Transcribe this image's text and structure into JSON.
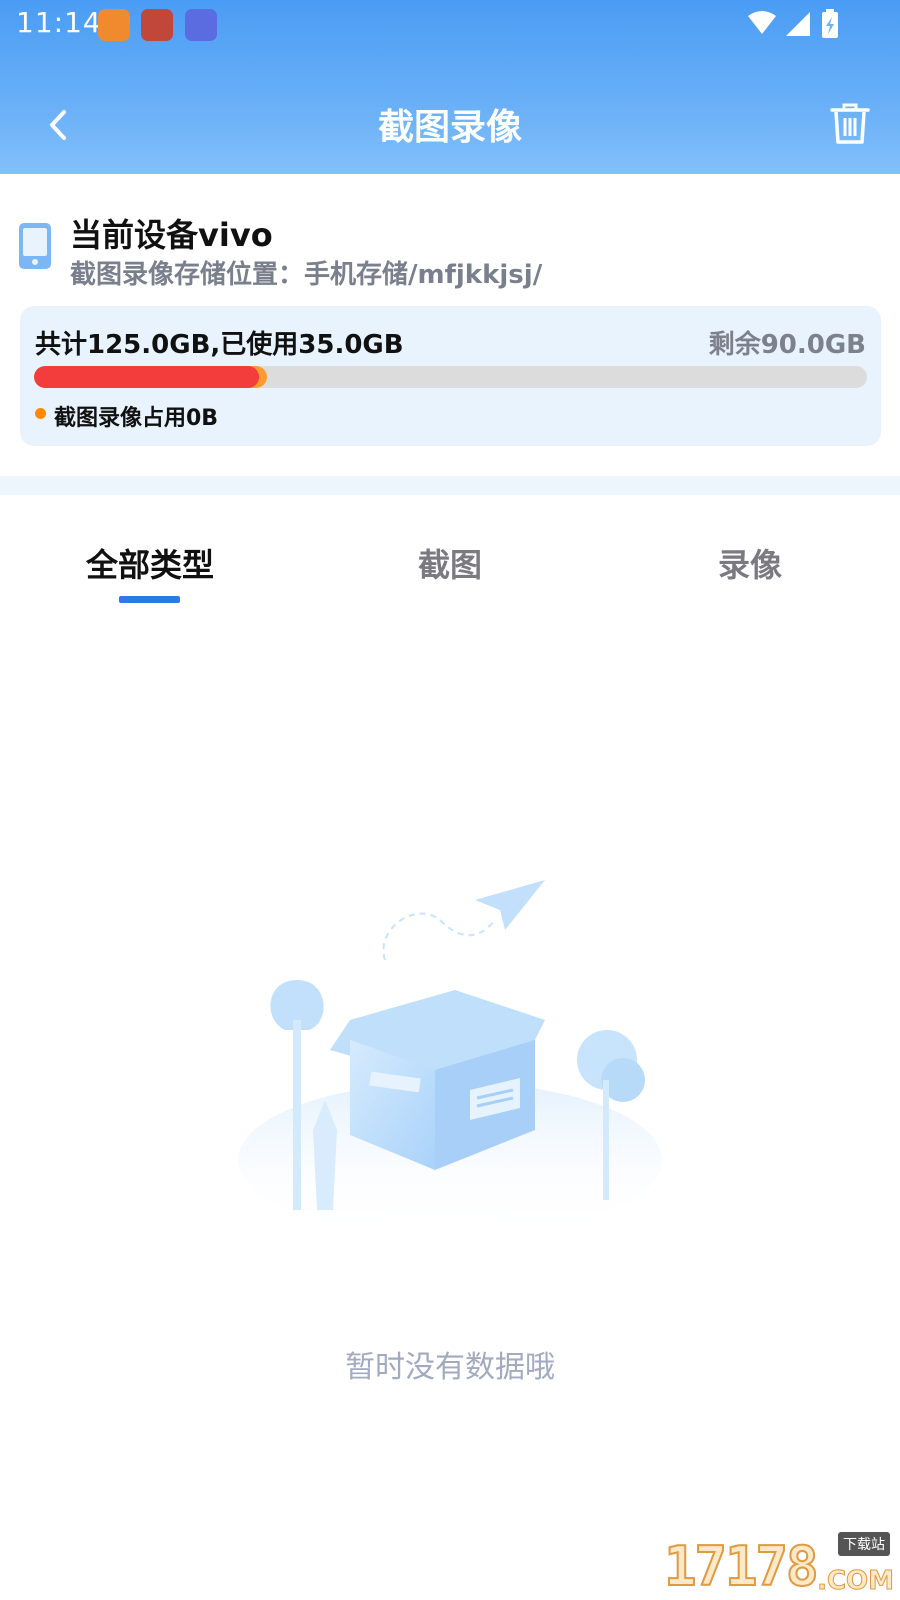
{
  "status_bar": {
    "time": "11:14"
  },
  "header": {
    "title": "截图录像"
  },
  "device": {
    "name": "当前设备vivo",
    "storage_path": "截图录像存储位置：手机存储/mfjkkjsj/"
  },
  "storage": {
    "total_text": "共计125.0GB,已使用35.0GB",
    "free_text": "剩余90.0GB",
    "used_fraction": 0.28,
    "red_fraction": 0.27,
    "legend_text": "截图录像占用0B",
    "colors": {
      "red": "#f33d3d",
      "orange": "#ff9a2e",
      "track": "#dcdcdc"
    }
  },
  "tabs": [
    {
      "label": "全部类型",
      "active": true
    },
    {
      "label": "截图",
      "active": false
    },
    {
      "label": "录像",
      "active": false
    }
  ],
  "empty_state": {
    "text": "暂时没有数据哦"
  },
  "watermark": {
    "number": "17178",
    "tag": "下载站",
    "domain": ".COM"
  },
  "icons": [
    "back-icon",
    "trash-icon",
    "phone-icon",
    "wifi-icon",
    "signal-icon",
    "battery-icon"
  ],
  "accent_color": "#2b7be6"
}
